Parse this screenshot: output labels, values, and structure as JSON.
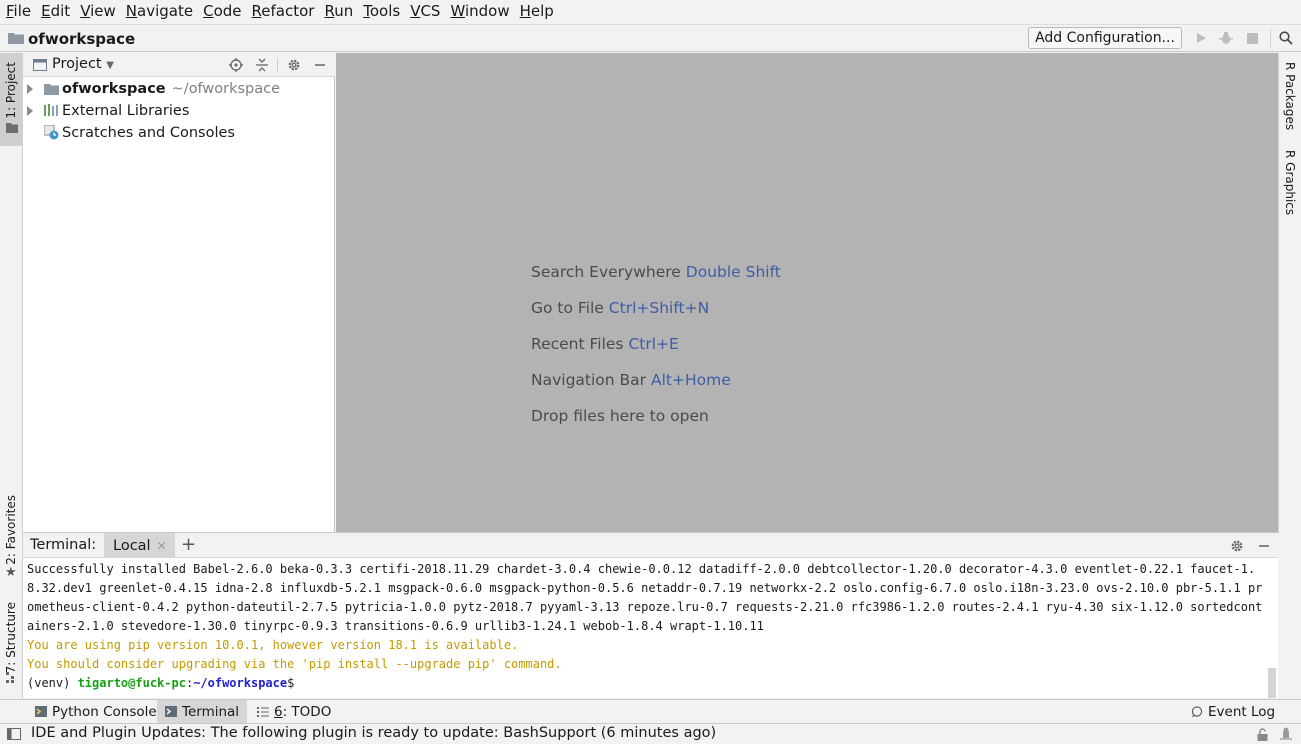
{
  "menubar": {
    "items": [
      {
        "mnemonic": "F",
        "rest": "ile"
      },
      {
        "mnemonic": "E",
        "rest": "dit"
      },
      {
        "mnemonic": "V",
        "rest": "iew"
      },
      {
        "mnemonic": "N",
        "rest": "avigate"
      },
      {
        "mnemonic": "C",
        "rest": "ode"
      },
      {
        "mnemonic": "R",
        "rest": "efactor"
      },
      {
        "mnemonic": "R",
        "rest": "un"
      },
      {
        "mnemonic": "T",
        "rest": "ools"
      },
      {
        "mnemonic": "V",
        "rest": "CS"
      },
      {
        "mnemonic": "W",
        "rest": "indow"
      },
      {
        "mnemonic": "H",
        "rest": "elp"
      }
    ]
  },
  "navbar": {
    "project_name": "ofworkspace",
    "add_configuration": "Add Configuration..."
  },
  "left_strip": {
    "project": "1: Project",
    "favorites": "2: Favorites",
    "structure": "7: Structure"
  },
  "right_strip": {
    "r_packages": "R Packages",
    "r_graphics": "R Graphics"
  },
  "project_panel": {
    "title": "Project",
    "tree": {
      "root_name": "ofworkspace",
      "root_path": "~/ofworkspace",
      "external_libraries": "External Libraries",
      "scratches": "Scratches and Consoles"
    }
  },
  "editor": {
    "hints": [
      {
        "text": "Search Everywhere",
        "key": "Double Shift"
      },
      {
        "text": "Go to File",
        "key": "Ctrl+Shift+N"
      },
      {
        "text": "Recent Files",
        "key": "Ctrl+E"
      },
      {
        "text": "Navigation Bar",
        "key": "Alt+Home"
      },
      {
        "text": "Drop files here to open",
        "key": ""
      }
    ]
  },
  "terminal": {
    "title": "Terminal:",
    "tab": "Local",
    "output": "Successfully installed Babel-2.6.0 beka-0.3.3 certifi-2018.11.29 chardet-3.0.4 chewie-0.0.12 datadiff-2.0.0 debtcollector-1.20.0 decorator-4.3.0 eventlet-0.22.1 faucet-1.8.32.dev1 greenlet-0.4.15 idna-2.8 influxdb-5.2.1 msgpack-0.6.0 msgpack-python-0.5.6 netaddr-0.7.19 networkx-2.2 oslo.config-6.7.0 oslo.i18n-3.23.0 ovs-2.10.0 pbr-5.1.1 prometheus-client-0.4.2 python-dateutil-2.7.5 pytricia-1.0.0 pytz-2018.7 pyyaml-3.13 repoze.lru-0.7 requests-2.21.0 rfc3986-1.2.0 routes-2.4.1 ryu-4.30 six-1.12.0 sortedcontainers-2.1.0 stevedore-1.30.0 tinyrpc-0.9.3 transitions-0.6.9 urllib3-1.24.1 webob-1.8.4 wrapt-1.10.11",
    "warning1": "You are using pip version 10.0.1, however version 18.1 is available.",
    "warning2": "You should consider upgrading via the 'pip install --upgrade pip' command.",
    "prompt_env": "(venv) ",
    "prompt_user": "tigarto@fuck-pc",
    "prompt_sep": ":",
    "prompt_path": "~/ofworkspace",
    "prompt_end": "$"
  },
  "bottom_bar": {
    "python_console": "Python Console",
    "terminal": "Terminal",
    "todo_num": "6",
    "todo_rest": ": TODO",
    "event_log": "Event Log"
  },
  "status": {
    "message": "IDE and Plugin Updates: The following plugin is ready to update: BashSupport (6 minutes ago)"
  }
}
